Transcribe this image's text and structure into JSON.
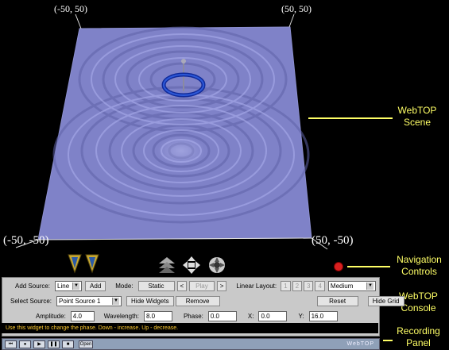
{
  "scene": {
    "corner_top_left": "(-50, 50)",
    "corner_top_right": "(50, 50)",
    "corner_bottom_left": "(-50, -50)",
    "corner_bottom_right": "(50, -50)",
    "surface_color": "#7f82c8"
  },
  "callouts": {
    "scene_line1": "WebTOP",
    "scene_line2": "Scene",
    "nav_line1": "Navigation",
    "nav_line2": "Controls",
    "console_line1": "WebTOP",
    "console_line2": "Console",
    "rec_line1": "Recording",
    "rec_line2": "Panel"
  },
  "console": {
    "add_source_label": "Add Source:",
    "add_source_value": "Line",
    "add_button": "Add",
    "mode_label": "Mode:",
    "mode_value": "Static",
    "prev_arrow": "<",
    "play_label": "Play",
    "next_arrow": ">",
    "linear_layout_label": "Linear Layout:",
    "layout_buttons": [
      "1",
      "2",
      "3",
      "4"
    ],
    "quality_value": "Medium",
    "select_source_label": "Select Source:",
    "select_source_value": "Point Source 1",
    "hide_widgets_button": "Hide Widgets",
    "remove_button": "Remove",
    "reset_button": "Reset",
    "hide_grid_button": "Hide Grid",
    "amplitude_label": "Amplitude:",
    "amplitude_value": "4.0",
    "wavelength_label": "Wavelength:",
    "wavelength_value": "8.0",
    "phase_label": "Phase:",
    "phase_value": "0.0",
    "x_label": "X:",
    "x_value": "0.0",
    "y_label": "Y:",
    "y_value": "16.0",
    "status_text": "Use this widget to change the phase.  Down - increase.  Up - decrease."
  },
  "recording": {
    "open_button": "Open",
    "brand": "WebTOP"
  }
}
